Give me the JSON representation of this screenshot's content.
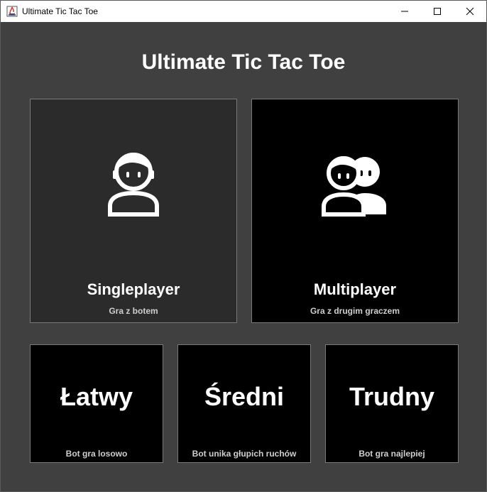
{
  "window": {
    "title": "Ultimate Tic Tac Toe",
    "icon": "java-app-icon",
    "controls": [
      "minimize-icon",
      "maximize-icon",
      "close-icon"
    ]
  },
  "heading": "Ultimate Tic Tac Toe",
  "modes": [
    {
      "title": "Singleplayer",
      "subtitle": "Gra z botem",
      "icon": "person-icon",
      "background": "#2b2b2b"
    },
    {
      "title": "Multiplayer",
      "subtitle": "Gra z drugim graczem",
      "icon": "two-people-icon",
      "background": "#000000"
    }
  ],
  "difficulties": [
    {
      "title": "Łatwy",
      "subtitle": "Bot gra losowo"
    },
    {
      "title": "Średni",
      "subtitle": "Bot unika głupich ruchów"
    },
    {
      "title": "Trudny",
      "subtitle": "Bot gra najlepiej"
    }
  ],
  "colors": {
    "background": "#404040",
    "text": "#ffffff",
    "subtext": "#cfcfcf",
    "border": "#7a7a7a"
  }
}
